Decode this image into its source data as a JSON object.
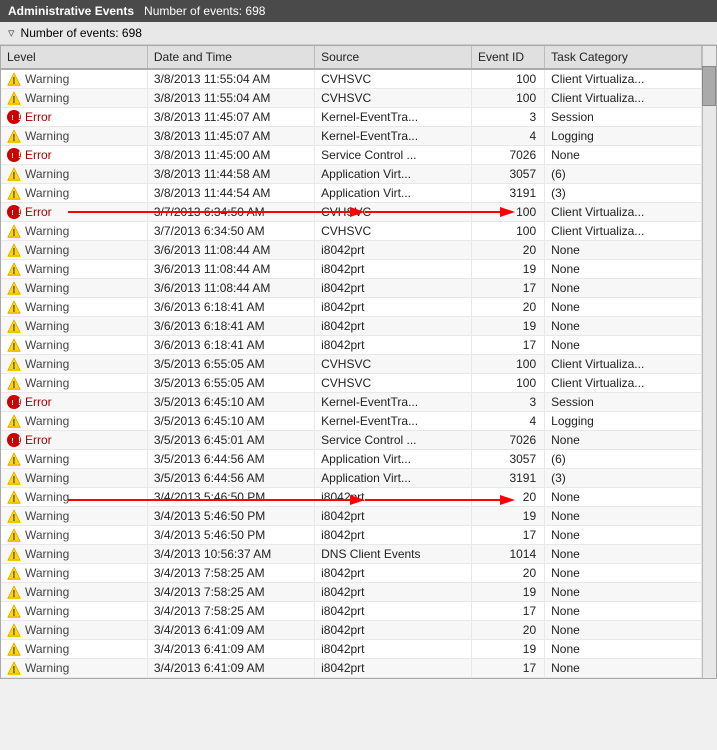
{
  "titleBar": {
    "title": "Administrative Events",
    "eventCount": "Number of events: 698"
  },
  "filterBar": {
    "label": "Number of events: 698"
  },
  "columns": [
    "Level",
    "Date and Time",
    "Source",
    "Event ID",
    "Task Category"
  ],
  "rows": [
    {
      "level": "Warning",
      "type": "warning",
      "datetime": "3/8/2013 11:55:04 AM",
      "source": "CVHSVC",
      "eventId": "100",
      "taskCategory": "Client Virtualiza..."
    },
    {
      "level": "Warning",
      "type": "warning",
      "datetime": "3/8/2013 11:55:04 AM",
      "source": "CVHSVC",
      "eventId": "100",
      "taskCategory": "Client Virtualiza..."
    },
    {
      "level": "Error",
      "type": "error",
      "datetime": "3/8/2013 11:45:07 AM",
      "source": "Kernel-EventTra...",
      "eventId": "3",
      "taskCategory": "Session"
    },
    {
      "level": "Warning",
      "type": "warning",
      "datetime": "3/8/2013 11:45:07 AM",
      "source": "Kernel-EventTra...",
      "eventId": "4",
      "taskCategory": "Logging"
    },
    {
      "level": "Error",
      "type": "error",
      "datetime": "3/8/2013 11:45:00 AM",
      "source": "Service Control ...",
      "eventId": "7026",
      "taskCategory": "None",
      "annotated": true
    },
    {
      "level": "Warning",
      "type": "warning",
      "datetime": "3/8/2013 11:44:58 AM",
      "source": "Application Virt...",
      "eventId": "3057",
      "taskCategory": "(6)"
    },
    {
      "level": "Warning",
      "type": "warning",
      "datetime": "3/8/2013 11:44:54 AM",
      "source": "Application Virt...",
      "eventId": "3191",
      "taskCategory": "(3)"
    },
    {
      "level": "Error",
      "type": "error",
      "datetime": "3/7/2013 6:34:50 AM",
      "source": "CVHSVC",
      "eventId": "100",
      "taskCategory": "Client Virtualiza..."
    },
    {
      "level": "Warning",
      "type": "warning",
      "datetime": "3/7/2013 6:34:50 AM",
      "source": "CVHSVC",
      "eventId": "100",
      "taskCategory": "Client Virtualiza..."
    },
    {
      "level": "Warning",
      "type": "warning",
      "datetime": "3/6/2013 11:08:44 AM",
      "source": "i8042prt",
      "eventId": "20",
      "taskCategory": "None"
    },
    {
      "level": "Warning",
      "type": "warning",
      "datetime": "3/6/2013 11:08:44 AM",
      "source": "i8042prt",
      "eventId": "19",
      "taskCategory": "None"
    },
    {
      "level": "Warning",
      "type": "warning",
      "datetime": "3/6/2013 11:08:44 AM",
      "source": "i8042prt",
      "eventId": "17",
      "taskCategory": "None"
    },
    {
      "level": "Warning",
      "type": "warning",
      "datetime": "3/6/2013 6:18:41 AM",
      "source": "i8042prt",
      "eventId": "20",
      "taskCategory": "None"
    },
    {
      "level": "Warning",
      "type": "warning",
      "datetime": "3/6/2013 6:18:41 AM",
      "source": "i8042prt",
      "eventId": "19",
      "taskCategory": "None"
    },
    {
      "level": "Warning",
      "type": "warning",
      "datetime": "3/6/2013 6:18:41 AM",
      "source": "i8042prt",
      "eventId": "17",
      "taskCategory": "None"
    },
    {
      "level": "Warning",
      "type": "warning",
      "datetime": "3/5/2013 6:55:05 AM",
      "source": "CVHSVC",
      "eventId": "100",
      "taskCategory": "Client Virtualiza..."
    },
    {
      "level": "Warning",
      "type": "warning",
      "datetime": "3/5/2013 6:55:05 AM",
      "source": "CVHSVC",
      "eventId": "100",
      "taskCategory": "Client Virtualiza..."
    },
    {
      "level": "Error",
      "type": "error",
      "datetime": "3/5/2013 6:45:10 AM",
      "source": "Kernel-EventTra...",
      "eventId": "3",
      "taskCategory": "Session"
    },
    {
      "level": "Warning",
      "type": "warning",
      "datetime": "3/5/2013 6:45:10 AM",
      "source": "Kernel-EventTra...",
      "eventId": "4",
      "taskCategory": "Logging"
    },
    {
      "level": "Error",
      "type": "error",
      "datetime": "3/5/2013 6:45:01 AM",
      "source": "Service Control ...",
      "eventId": "7026",
      "taskCategory": "None",
      "annotated": true
    },
    {
      "level": "Warning",
      "type": "warning",
      "datetime": "3/5/2013 6:44:56 AM",
      "source": "Application Virt...",
      "eventId": "3057",
      "taskCategory": "(6)"
    },
    {
      "level": "Warning",
      "type": "warning",
      "datetime": "3/5/2013 6:44:56 AM",
      "source": "Application Virt...",
      "eventId": "3191",
      "taskCategory": "(3)"
    },
    {
      "level": "Warning",
      "type": "warning",
      "datetime": "3/4/2013 5:46:50 PM",
      "source": "i8042prt",
      "eventId": "20",
      "taskCategory": "None"
    },
    {
      "level": "Warning",
      "type": "warning",
      "datetime": "3/4/2013 5:46:50 PM",
      "source": "i8042prt",
      "eventId": "19",
      "taskCategory": "None"
    },
    {
      "level": "Warning",
      "type": "warning",
      "datetime": "3/4/2013 5:46:50 PM",
      "source": "i8042prt",
      "eventId": "17",
      "taskCategory": "None"
    },
    {
      "level": "Warning",
      "type": "warning",
      "datetime": "3/4/2013 10:56:37 AM",
      "source": "DNS Client Events",
      "eventId": "1014",
      "taskCategory": "None"
    },
    {
      "level": "Warning",
      "type": "warning",
      "datetime": "3/4/2013 7:58:25 AM",
      "source": "i8042prt",
      "eventId": "20",
      "taskCategory": "None"
    },
    {
      "level": "Warning",
      "type": "warning",
      "datetime": "3/4/2013 7:58:25 AM",
      "source": "i8042prt",
      "eventId": "19",
      "taskCategory": "None"
    },
    {
      "level": "Warning",
      "type": "warning",
      "datetime": "3/4/2013 7:58:25 AM",
      "source": "i8042prt",
      "eventId": "17",
      "taskCategory": "None"
    },
    {
      "level": "Warning",
      "type": "warning",
      "datetime": "3/4/2013 6:41:09 AM",
      "source": "i8042prt",
      "eventId": "20",
      "taskCategory": "None"
    },
    {
      "level": "Warning",
      "type": "warning",
      "datetime": "3/4/2013 6:41:09 AM",
      "source": "i8042prt",
      "eventId": "19",
      "taskCategory": "None"
    },
    {
      "level": "Warning",
      "type": "warning",
      "datetime": "3/4/2013 6:41:09 AM",
      "source": "i8042prt",
      "eventId": "17",
      "taskCategory": "None"
    }
  ]
}
